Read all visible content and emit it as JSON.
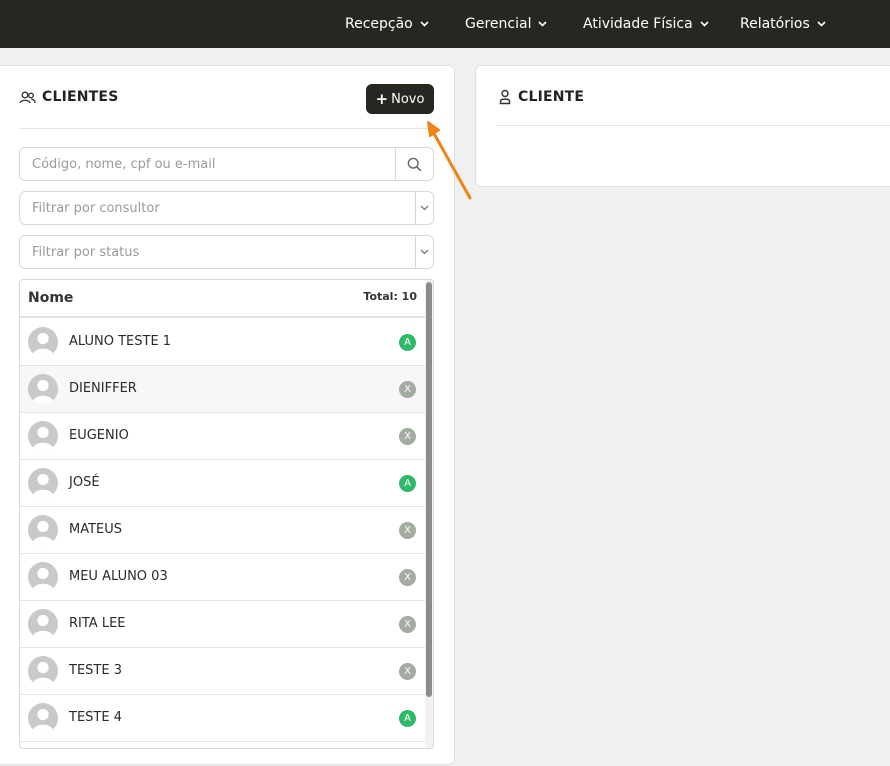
{
  "nav": {
    "items": [
      {
        "label": "Recepção"
      },
      {
        "label": "Gerencial"
      },
      {
        "label": "Atividade Física"
      },
      {
        "label": "Relatórios"
      }
    ]
  },
  "clientes_panel": {
    "title": "CLIENTES",
    "new_button": "Novo",
    "search_placeholder": "Código, nome, cpf ou e-mail",
    "consultor_placeholder": "Filtrar por consultor",
    "status_placeholder": "Filtrar por status",
    "list": {
      "header_name": "Nome",
      "total_label": "Total: 10",
      "rows": [
        {
          "name": "ALUNO TESTE 1",
          "status": "A"
        },
        {
          "name": "DIENIFFER",
          "status": "X"
        },
        {
          "name": "EUGENIO",
          "status": "X"
        },
        {
          "name": "JOSÉ",
          "status": "A"
        },
        {
          "name": "MATEUS",
          "status": "X"
        },
        {
          "name": "MEU ALUNO 03",
          "status": "X"
        },
        {
          "name": "RITA LEE",
          "status": "X"
        },
        {
          "name": "TESTE 3",
          "status": "X"
        },
        {
          "name": "TESTE 4",
          "status": "A"
        }
      ]
    }
  },
  "cliente_panel": {
    "title": "CLIENTE"
  },
  "colors": {
    "topbar": "#252821",
    "status_active": "#2fb86a",
    "status_inactive": "#a3aca0",
    "annotation_arrow": "#f08418"
  },
  "icons": [
    "users-icon",
    "plus-icon",
    "search-icon",
    "chevron-down-icon",
    "user-icon",
    "avatar-icon",
    "arrow-annotation"
  ]
}
